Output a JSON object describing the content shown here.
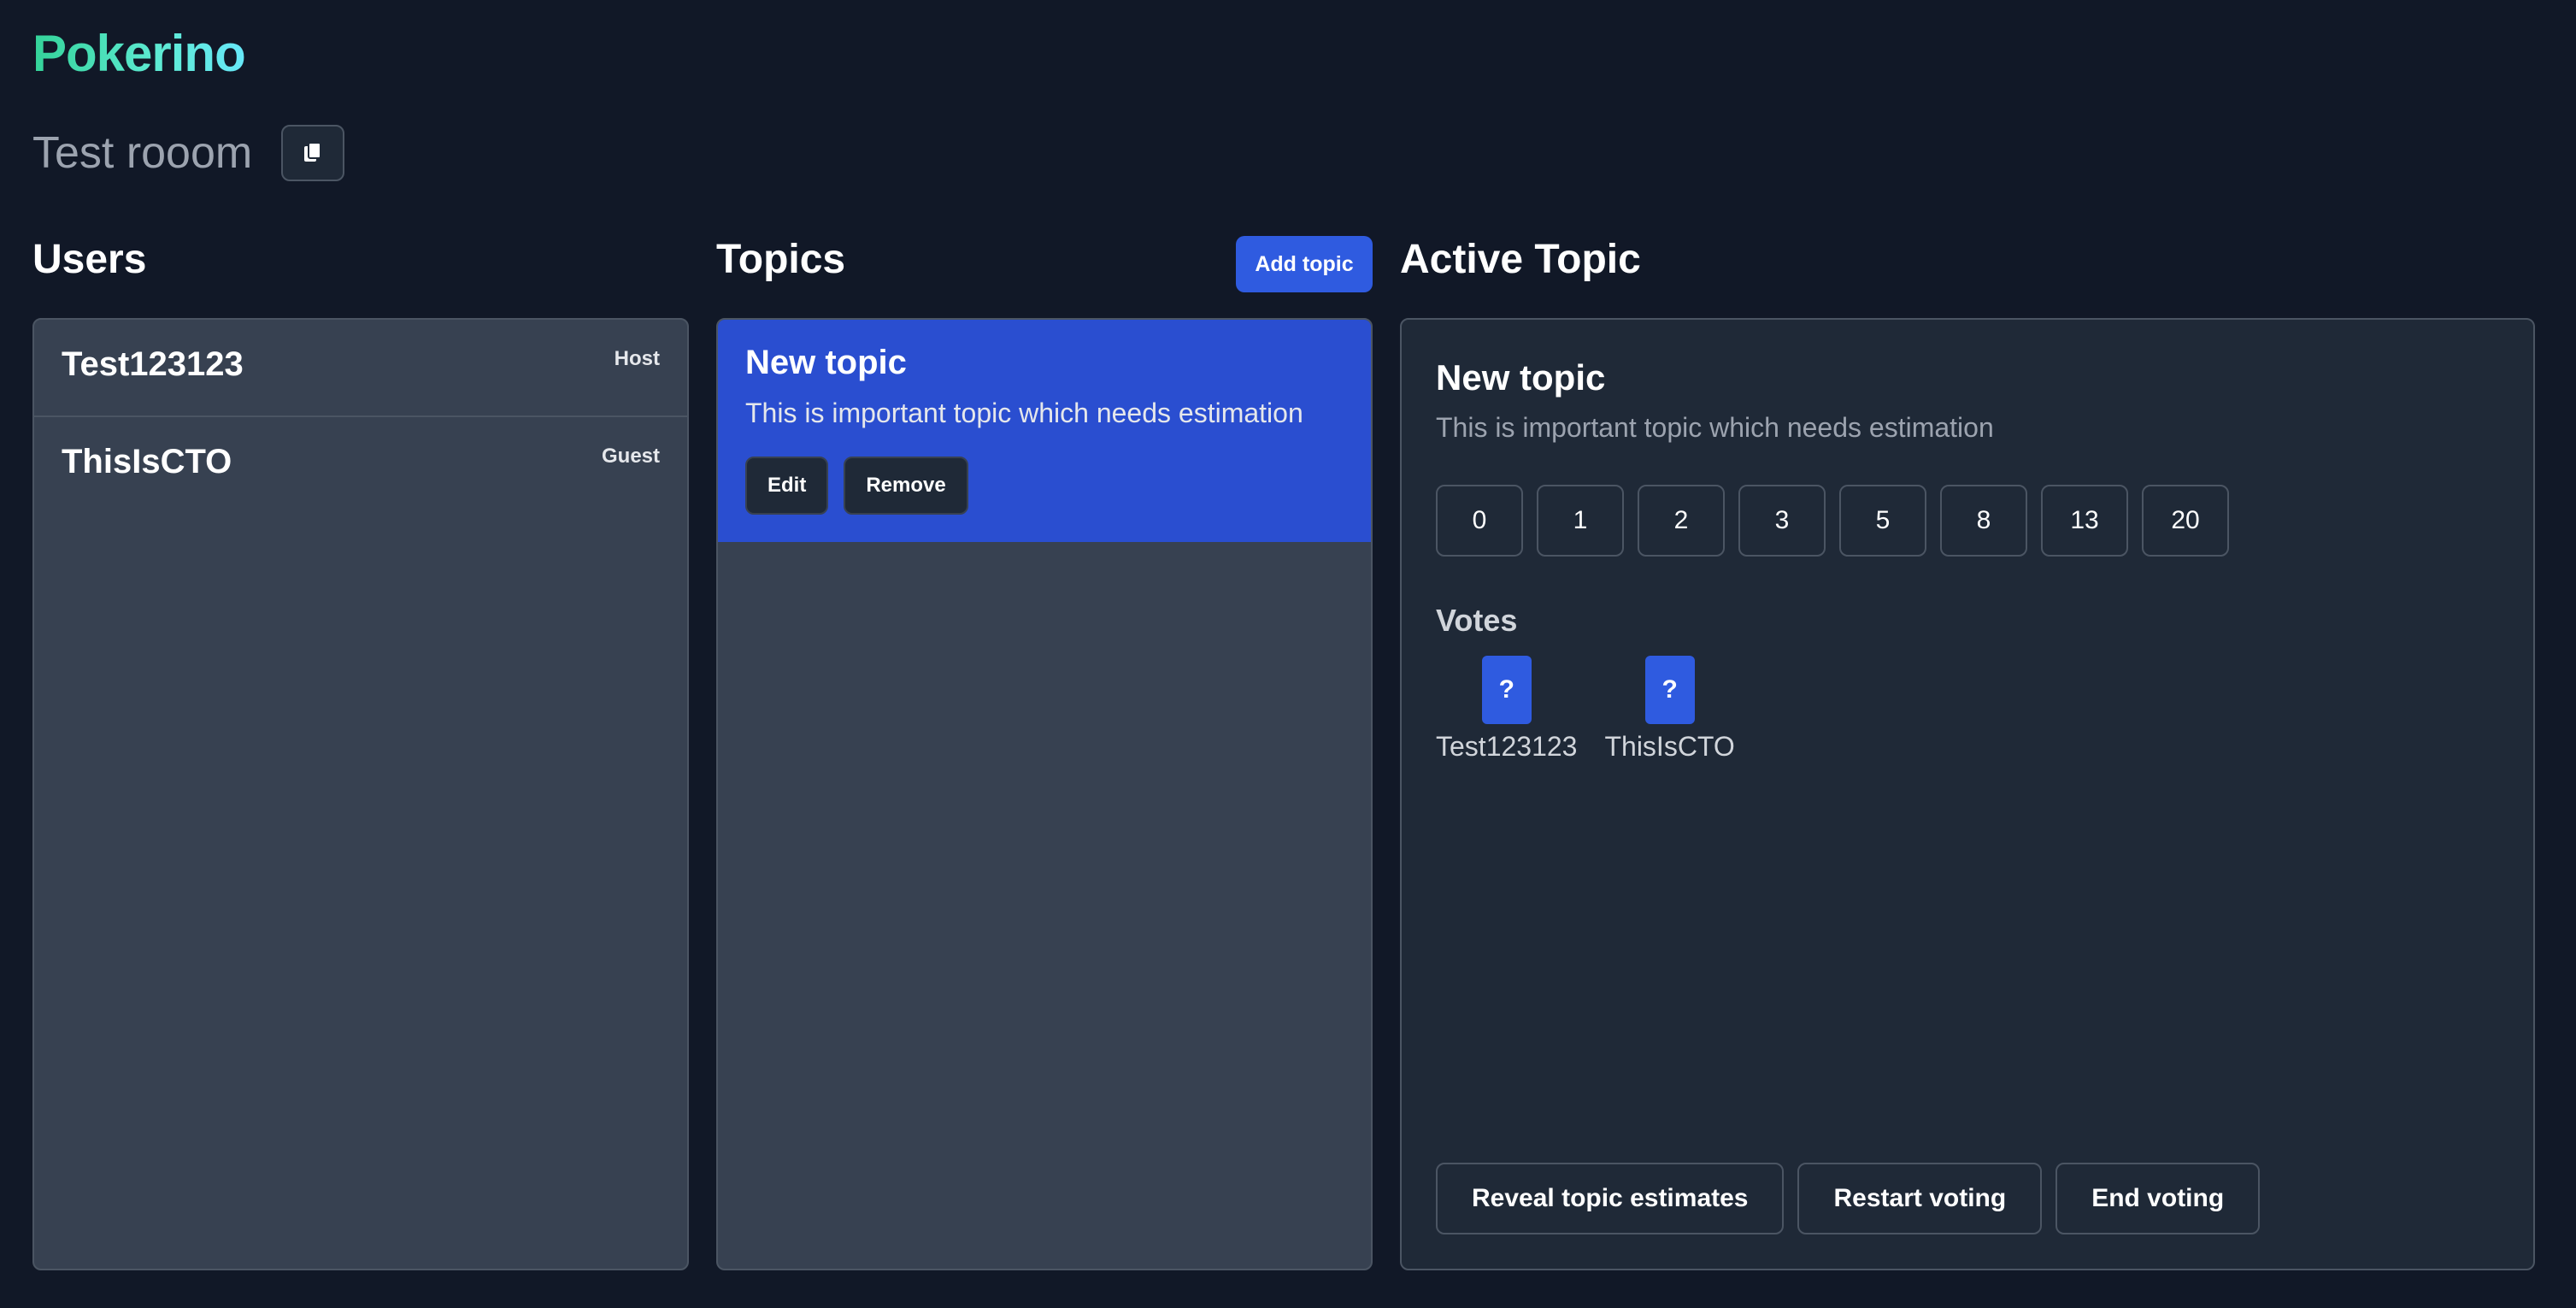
{
  "app": {
    "logo": "Pokerino"
  },
  "room": {
    "name": "Test rooom",
    "copy_icon": "copy-icon"
  },
  "users": {
    "title": "Users",
    "items": [
      {
        "name": "Test123123",
        "role": "Host"
      },
      {
        "name": "ThisIsCTO",
        "role": "Guest"
      }
    ]
  },
  "topics": {
    "title": "Topics",
    "add_label": "Add topic",
    "items": [
      {
        "title": "New topic",
        "description": "This is important topic which needs estimation",
        "edit_label": "Edit",
        "remove_label": "Remove"
      }
    ]
  },
  "active": {
    "heading": "Active Topic",
    "title": "New topic",
    "description": "This is important topic which needs estimation",
    "cards": [
      "0",
      "1",
      "2",
      "3",
      "5",
      "8",
      "13",
      "20"
    ],
    "votes_label": "Votes",
    "votes": [
      {
        "card": "?",
        "user": "Test123123"
      },
      {
        "card": "?",
        "user": "ThisIsCTO"
      }
    ],
    "reveal_label": "Reveal topic estimates",
    "restart_label": "Restart voting",
    "end_label": "End voting"
  },
  "colors": {
    "background": "#111827",
    "accent": "#2f5be0",
    "selected_topic": "#2a4ed0",
    "logo_gradient": [
      "#34d399",
      "#67e8f9"
    ]
  }
}
